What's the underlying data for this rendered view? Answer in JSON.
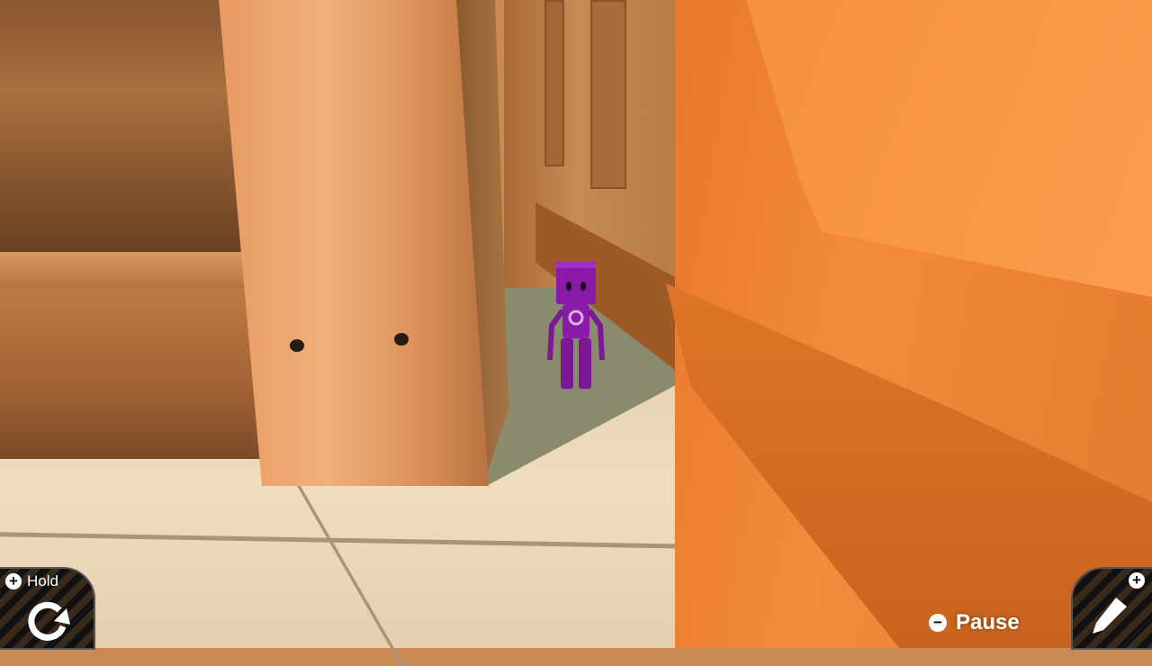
{
  "hud": {
    "hold": {
      "button": "+",
      "label": "Hold",
      "icon": "rotate-clockwise-icon"
    },
    "pause": {
      "button": "−",
      "label": "Pause"
    },
    "edit": {
      "button": "+",
      "icon": "pencil-icon"
    }
  },
  "colors": {
    "character": "#8a1aa8",
    "cabinet": "#f48a3c"
  }
}
